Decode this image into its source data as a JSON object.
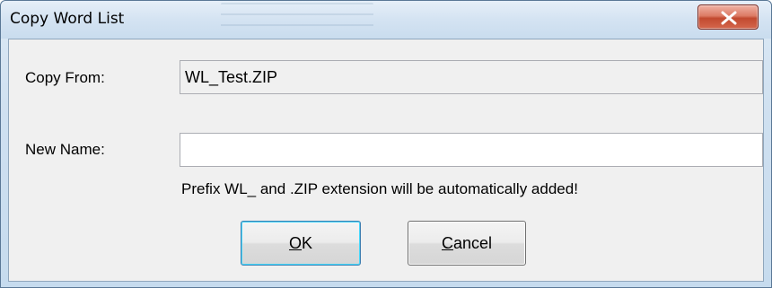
{
  "window": {
    "title": "Copy Word List",
    "close_glyph": "close-icon"
  },
  "form": {
    "copy_from_label": "Copy From:",
    "copy_from_value": "WL_Test.ZIP",
    "new_name_label": "New Name:",
    "new_name_value": "",
    "hint": "Prefix WL_ and .ZIP extension will be automatically added!"
  },
  "buttons": {
    "ok_mnemonic": "O",
    "ok_rest": "K",
    "cancel_mnemonic": "C",
    "cancel_rest": "ancel"
  },
  "colors": {
    "close_button": "#c24a30",
    "client_background": "#f0f0f0",
    "frame": "#cfe0f0"
  }
}
